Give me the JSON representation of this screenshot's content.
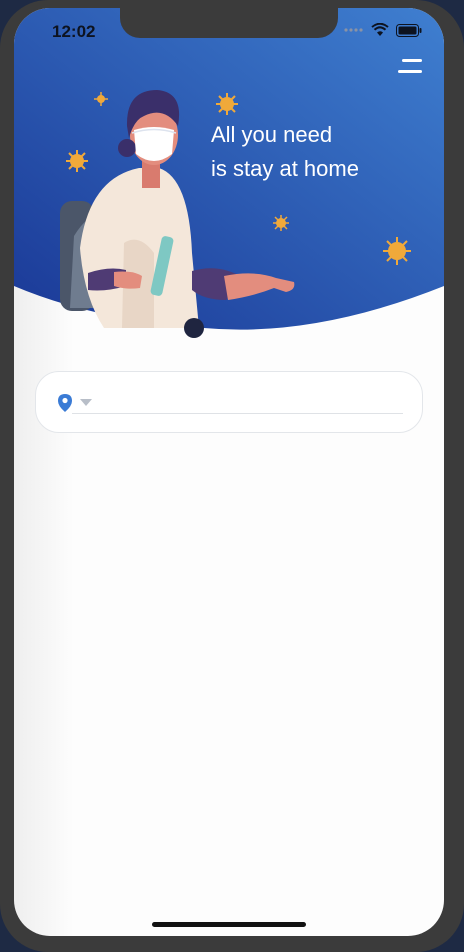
{
  "status_bar": {
    "time": "12:02",
    "icons": [
      "signal-dots-icon",
      "wifi-icon",
      "battery-icon"
    ]
  },
  "header": {
    "menu_icon": "menu-icon",
    "headline_line1": "All you need",
    "headline_line2": "is stay at home",
    "gradient_start": "#1a3896",
    "gradient_end": "#3f7fd0",
    "virus_color": "#f0a93a"
  },
  "location_selector": {
    "pin_icon": "location-pin-icon",
    "pin_color": "#3a7bd5",
    "dropdown_icon": "chevron-down-icon",
    "value": ""
  }
}
